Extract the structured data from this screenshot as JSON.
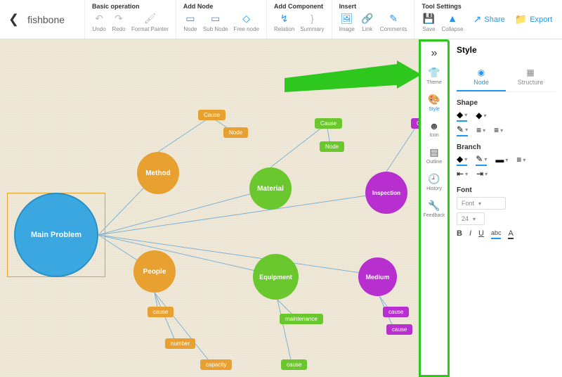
{
  "title": "fishbone",
  "toolbar": {
    "basic": {
      "label": "Basic operation",
      "undo": "Undo",
      "redo": "Redo",
      "format_painter": "Format Painter"
    },
    "add_node": {
      "label": "Add Node",
      "node": "Node",
      "sub_node": "Sub Node",
      "free_node": "Free node"
    },
    "add_component": {
      "label": "Add Component",
      "relation": "Relation",
      "summary": "Summary"
    },
    "insert": {
      "label": "Insert",
      "image": "Image",
      "link": "Link",
      "comments": "Comments"
    },
    "tool_settings": {
      "label": "Tool Settings",
      "save": "Save",
      "collapse": "Collapse"
    },
    "share": "Share",
    "export": "Export"
  },
  "sidetools": {
    "theme": "Theme",
    "style": "Style",
    "icon": "Icon",
    "outline": "Outline",
    "history": "History",
    "feedback": "Feedback"
  },
  "panel": {
    "title": "Style",
    "tabs": {
      "node": "Node",
      "structure": "Structure"
    },
    "shape_label": "Shape",
    "branch_label": "Branch",
    "font_label": "Font",
    "font_placeholder": "Font",
    "font_size": "24",
    "bold": "B",
    "italic": "I",
    "underline": "U",
    "abc": "abc",
    "color": "A"
  },
  "nodes": {
    "main": "Main Problem",
    "method": "Method",
    "people": "People",
    "material": "Material",
    "equipment": "Equipment",
    "inspection": "Inspection",
    "medium": "Medium",
    "cause": "Cause",
    "node": "Node",
    "cause_l": "cause",
    "number": "number",
    "capacity": "capacity",
    "maintenance": "maintenance"
  }
}
